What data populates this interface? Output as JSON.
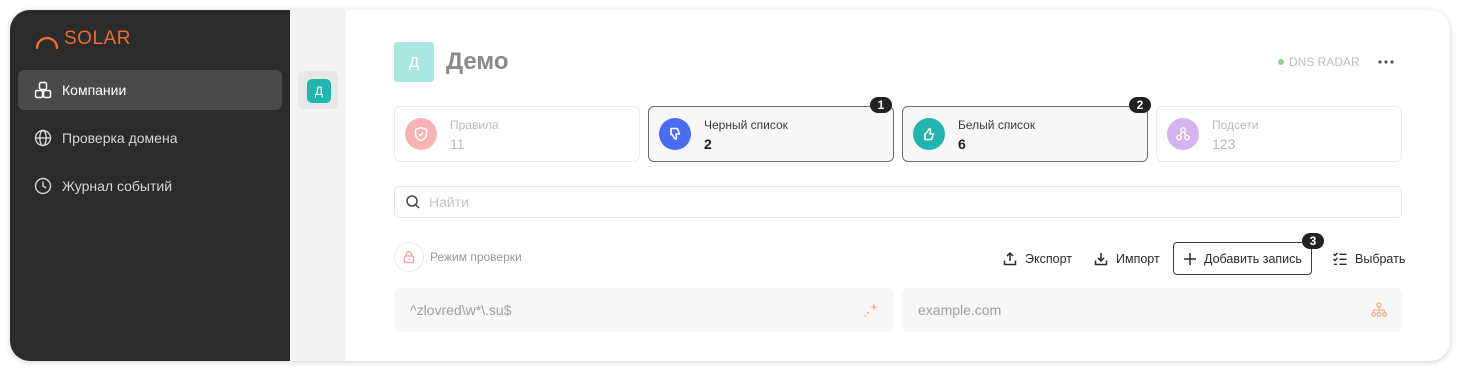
{
  "sidebar": {
    "logo_text": "SOLAR",
    "items": [
      {
        "label": "Компании",
        "icon": "companies-icon",
        "active": true
      },
      {
        "label": "Проверка домена",
        "icon": "globe-icon",
        "active": false
      },
      {
        "label": "Журнал событий",
        "icon": "clock-icon",
        "active": false
      }
    ]
  },
  "rail": {
    "badge": "Д"
  },
  "header": {
    "avatar_letter": "Д",
    "title": "Демо",
    "dns_status": "DNS RADAR"
  },
  "stats": [
    {
      "label": "Правила",
      "value": "11",
      "icon": "shield-icon",
      "color": "#f8b4b4",
      "selected": false
    },
    {
      "label": "Черный список",
      "value": "2",
      "icon": "thumbs-down-icon",
      "color": "#4a6cf0",
      "selected": true,
      "marker": "1"
    },
    {
      "label": "Белый список",
      "value": "6",
      "icon": "thumbs-up-icon",
      "color": "#22b5b0",
      "selected": true,
      "marker": "2"
    },
    {
      "label": "Подсети",
      "value": "123",
      "icon": "network-icon",
      "color": "#d6b2ee",
      "selected": false
    }
  ],
  "search": {
    "placeholder": "Найти"
  },
  "mode": {
    "label": "Режим проверки"
  },
  "actions": {
    "export": "Экспорт",
    "import": "Импорт",
    "add": "Добавить запись",
    "add_marker": "3",
    "select": "Выбрать"
  },
  "entries": [
    {
      "value": "^zlovred\\w*\\.su$",
      "icon": "sparkle-icon"
    },
    {
      "value": "example.com",
      "icon": "hierarchy-icon"
    }
  ],
  "colors": {
    "brand": "#f26a2e",
    "sidebar_bg": "#2b2b2b",
    "accent": "#22b5b0"
  }
}
